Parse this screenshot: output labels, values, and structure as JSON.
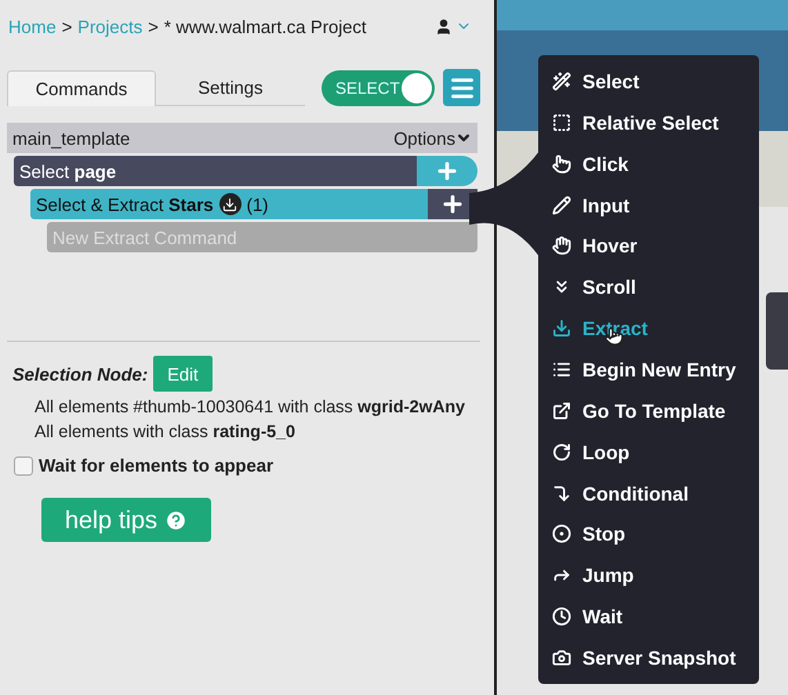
{
  "breadcrumb": [
    {
      "kind": "link",
      "label": "Home"
    },
    {
      "kind": "separator",
      "label": ">"
    },
    {
      "kind": "link",
      "label": "Projects"
    },
    {
      "kind": "separator",
      "label": ">"
    },
    {
      "kind": "current",
      "label": "* www.walmart.ca Project"
    }
  ],
  "tabs": [
    {
      "label": "Commands",
      "selected": true
    },
    {
      "label": "Settings",
      "selected": false
    }
  ],
  "select_toggle": {
    "label": "SELECT",
    "on": true
  },
  "template": {
    "name": "main_template",
    "options": "Options"
  },
  "commands": [
    {
      "kind": "select",
      "label": "Select **page**",
      "children": [
        {
          "kind": "extract",
          "label": "Select & Extract **Stars**",
          "count": "(1)",
          "children": [
            {
              "kind": "new",
              "label": "New Extract Command"
            }
          ]
        }
      ]
    }
  ],
  "selection": {
    "title": "Selection Node:",
    "edit": "Edit",
    "lines": [
      "All elements #thumb-10030641 with class **wgrid-2wAny**",
      "All elements with class **rating-5_0**"
    ]
  },
  "wait_checkbox": {
    "label": "Wait for elements to appear",
    "checked": false
  },
  "help_button": "help tips",
  "menu": [
    {
      "label": "Select",
      "selected": false
    },
    {
      "label": "Relative Select",
      "selected": false
    },
    {
      "label": "Click",
      "selected": false
    },
    {
      "label": "Input",
      "selected": false
    },
    {
      "label": "Hover",
      "selected": false
    },
    {
      "label": "Scroll",
      "selected": false
    },
    {
      "label": "Extract",
      "selected": true
    },
    {
      "label": "Begin New Entry",
      "selected": false
    },
    {
      "label": "Go To Template",
      "selected": false
    },
    {
      "label": "Loop",
      "selected": false
    },
    {
      "label": "Conditional",
      "selected": false
    },
    {
      "label": "Stop",
      "selected": false
    },
    {
      "label": "Jump",
      "selected": false
    },
    {
      "label": "Wait",
      "selected": false
    },
    {
      "label": "Server Snapshot",
      "selected": false
    }
  ]
}
